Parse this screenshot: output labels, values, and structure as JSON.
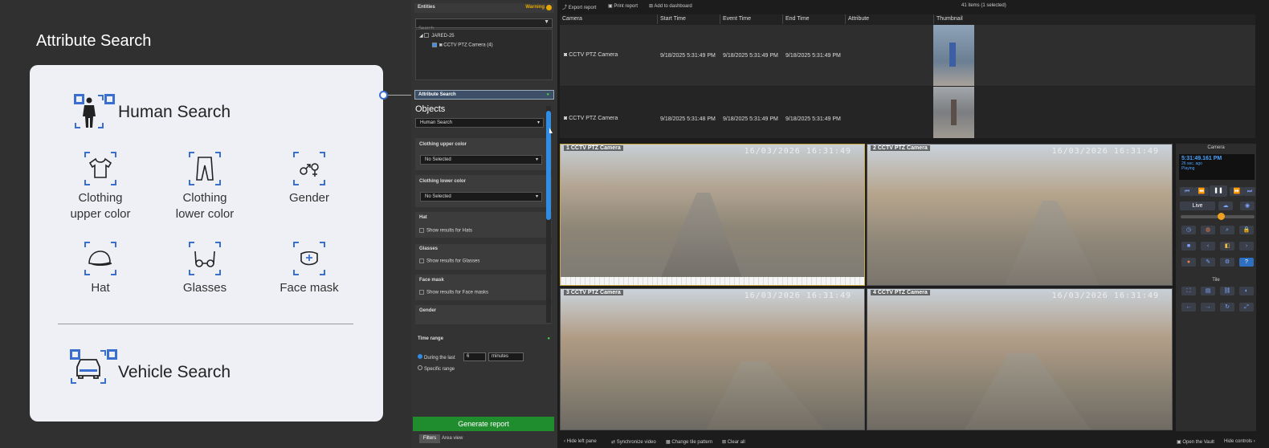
{
  "promo": {
    "title": "Attribute Search",
    "human_search": "Human Search",
    "attributes": [
      {
        "label": "Clothing\nupper color",
        "icon": "shirt-icon"
      },
      {
        "label": "Clothing\nlower color",
        "icon": "pants-icon"
      },
      {
        "label": "Gender",
        "icon": "gender-icon"
      },
      {
        "label": "Hat",
        "icon": "cap-icon"
      },
      {
        "label": "Glasses",
        "icon": "glasses-icon"
      },
      {
        "label": "Face mask",
        "icon": "face-mask-icon"
      }
    ],
    "vehicle_search": "Vehicle Search"
  },
  "toolbar": {
    "export": "Export report",
    "print": "Print report",
    "add": "Add to dashboard",
    "count": "41 items (1 selected)"
  },
  "left_pane": {
    "entities_title": "Entities",
    "warning": "Warning",
    "search_placeholder": "Search",
    "tree_root": "JARED-25",
    "tree_child": "CCTV PTZ Camera (4)",
    "attr_search_title": "Attribute Search",
    "objects_label": "Objects",
    "objects_value": "Human Search",
    "upper_label": "Clothing upper color",
    "upper_value": "No Selected",
    "lower_label": "Clothing lower color",
    "lower_value": "No Selected",
    "hat_label": "Hat",
    "hat_check": "Show results for Hats",
    "glasses_label": "Glasses",
    "glasses_check": "Show results for Glasses",
    "mask_label": "Face mask",
    "mask_check": "Show results for Face masks",
    "gender_label": "Gender",
    "time_title": "Time range",
    "during_label": "During the last",
    "during_value": "6",
    "unit_value": "minutes",
    "specific_label": "Specific range",
    "generate": "Generate report",
    "tab_filters": "Filters",
    "tab_area": "Area view"
  },
  "table": {
    "headers": [
      "Camera",
      "Start Time",
      "Event Time",
      "End Time",
      "Attribute",
      "Thumbnail"
    ],
    "rows": [
      {
        "camera": "CCTV PTZ Camera",
        "start": "9/18/2025 5:31:49 PM",
        "event": "9/18/2025 5:31:49 PM",
        "end": "9/18/2025 5:31:49 PM"
      },
      {
        "camera": "CCTV PTZ Camera",
        "start": "9/18/2025 5:31:48 PM",
        "event": "9/18/2025 5:31:49 PM",
        "end": "9/18/2025 5:31:49 PM"
      }
    ]
  },
  "tiles": [
    {
      "num": "1",
      "cam": "CCTV PTZ Camera",
      "ts": "16/03/2026 16:31:49"
    },
    {
      "num": "2",
      "cam": "CCTV PTZ Camera",
      "ts": "16/03/2026 16:31:49"
    },
    {
      "num": "3",
      "cam": "CCTV PTZ Camera",
      "ts": "16/03/2026 16:31:49"
    },
    {
      "num": "4",
      "cam": "CCTV PTZ Camera",
      "ts": "16/03/2026 16:31:49"
    }
  ],
  "right_pane": {
    "camera_title": "Camera",
    "time": "5:31:49.161 PM",
    "ago": "26 sec. ago",
    "state": "Playing",
    "live": "Live",
    "tile_title": "Tile"
  },
  "bottom": {
    "hide_left": "Hide left pane",
    "sync": "Synchronize video",
    "pattern": "Change tile pattern",
    "clear": "Clear all",
    "vault": "Open the Vault",
    "hide_controls": "Hide controls"
  }
}
